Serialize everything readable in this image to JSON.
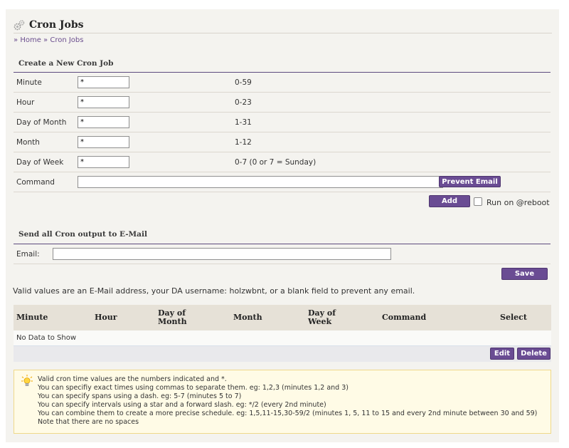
{
  "header": {
    "title": "Cron Jobs",
    "icon": "gear-icon"
  },
  "breadcrumb": {
    "sep": "»",
    "home": "Home",
    "current": "Cron Jobs"
  },
  "create_section": {
    "title": "Create a New Cron Job",
    "rows": [
      {
        "label": "Minute",
        "value": "*",
        "hint": "0-59"
      },
      {
        "label": "Hour",
        "value": "*",
        "hint": "0-23"
      },
      {
        "label": "Day of Month",
        "value": "*",
        "hint": "1-31"
      },
      {
        "label": "Month",
        "value": "*",
        "hint": "1-12"
      },
      {
        "label": "Day of Week",
        "value": "*",
        "hint": "0-7 (0 or 7 = Sunday)"
      }
    ],
    "command_label": "Command",
    "command_value": "",
    "prevent_email_label": "Prevent Email",
    "add_label": "Add",
    "run_reboot_label": "Run on @reboot"
  },
  "email_section": {
    "title": "Send all Cron output to E-Mail",
    "email_label": "Email:",
    "email_value": "",
    "save_label": "Save",
    "note": "Valid values are an E-Mail address, your DA username: holzwbnt, or a blank field to prevent any email."
  },
  "table": {
    "columns": [
      "Minute",
      "Hour",
      "Day of\nMonth",
      "Month",
      "Day of\nWeek",
      "Command",
      "Select"
    ],
    "empty_text": "No Data to Show",
    "edit_label": "Edit",
    "delete_label": "Delete"
  },
  "tips": {
    "icon": "lightbulb-icon",
    "lines": [
      "Valid cron time values are the numbers indicated and *.",
      "You can specifiy exact times using commas to separate them. eg: 1,2,3 (minutes 1,2 and 3)",
      "You can specify spans using a dash. eg: 5-7 (minutes 5 to 7)",
      "You can specify intervals using a star and a forward slash. eg: */2 (every 2nd minute)",
      "You can combine them to create a more precise schedule. eg: 1,5,11-15,30-59/2 (minutes 1, 5, 11 to 15 and every 2nd minute between 30 and 59)",
      "Note that there are no spaces"
    ]
  },
  "colors": {
    "accent": "#6a4c93",
    "panel": "#f4f3ef",
    "table_header": "#e6e1d7",
    "tip_background": "#fffbe6"
  }
}
